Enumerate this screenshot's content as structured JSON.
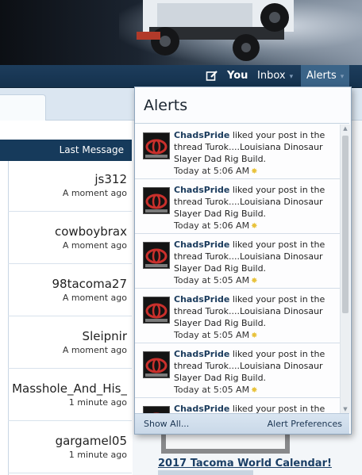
{
  "nav": {
    "you_label": "You",
    "inbox_label": "Inbox",
    "alerts_label": "Alerts",
    "compose_icon": "compose-icon",
    "caret_icon": "▾"
  },
  "last_message": {
    "header": "Last Message",
    "rows": [
      {
        "user": "js312",
        "time": "A moment ago"
      },
      {
        "user": "cowboybrax",
        "time": "A moment ago"
      },
      {
        "user": "98tacoma27",
        "time": "A moment ago"
      },
      {
        "user": "Sleipnir",
        "time": "A moment ago"
      },
      {
        "user": "Masshole_And_His_",
        "time": "1 minute ago"
      },
      {
        "user": "gargamel05",
        "time": "1 minute ago"
      }
    ]
  },
  "sidebar": {
    "calendar_link": "2017 Tacoma World Calendar!"
  },
  "alerts": {
    "title": "Alerts",
    "items": [
      {
        "user": "ChadsPride",
        "text": " liked your post in the thread Turok....Louisiana Dinosaur Slayer Dad Rig Build.",
        "time": "Today at 5:06 AM"
      },
      {
        "user": "ChadsPride",
        "text": " liked your post in the thread Turok....Louisiana Dinosaur Slayer Dad Rig Build.",
        "time": "Today at 5:06 AM"
      },
      {
        "user": "ChadsPride",
        "text": " liked your post in the thread Turok....Louisiana Dinosaur Slayer Dad Rig Build.",
        "time": "Today at 5:05 AM"
      },
      {
        "user": "ChadsPride",
        "text": " liked your post in the thread Turok....Louisiana Dinosaur Slayer Dad Rig Build.",
        "time": "Today at 5:05 AM"
      },
      {
        "user": "ChadsPride",
        "text": " liked your post in the thread Turok....Louisiana Dinosaur Slayer Dad Rig Build.",
        "time": "Today at 5:05 AM"
      },
      {
        "user": "ChadsPride",
        "text": " liked your post in the thread",
        "time": ""
      }
    ],
    "show_all": "Show All...",
    "preferences": "Alert Preferences"
  },
  "colors": {
    "nav_bg": "#163a5b",
    "alerts_active": "#3b6488",
    "link": "#193a5c",
    "star": "#e8c23b"
  }
}
